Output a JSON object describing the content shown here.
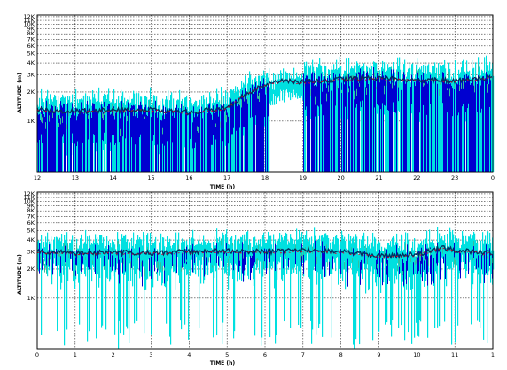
{
  "chart_data": [
    {
      "type": "area",
      "title": "",
      "xlabel": "TIME (h)",
      "ylabel": "ALTITUDE (m)",
      "x_ticks": [
        "12",
        "13",
        "14",
        "15",
        "16",
        "17",
        "18",
        "19",
        "20",
        "21",
        "22",
        "23",
        "0"
      ],
      "xlim": [
        12,
        24
      ],
      "y_ticks": [
        "12K",
        "11K",
        "10K",
        "9K",
        "8K",
        "7K",
        "6K",
        "5K",
        "4K",
        "3K",
        "2K",
        "1K"
      ],
      "y_scale": "log",
      "grid": true,
      "colors": {
        "low": "#00e0e0",
        "mid": "#0000d0",
        "high": "#30c0a0",
        "top": "#d00030",
        "dark": "#003060"
      },
      "series": [
        {
          "values": [
            {
              "x": 12.0,
              "y": 1300
            },
            {
              "x": 13.0,
              "y": 1250
            },
            {
              "x": 14.0,
              "y": 1280
            },
            {
              "x": 15.0,
              "y": 1300
            },
            {
              "x": 16.0,
              "y": 1220
            },
            {
              "x": 17.0,
              "y": 1350
            },
            {
              "x": 17.8,
              "y": 2200
            },
            {
              "x": 18.5,
              "y": 2600
            },
            {
              "x": 19.0,
              "y": 2500
            },
            {
              "x": 20.0,
              "y": 2700
            },
            {
              "x": 21.0,
              "y": 2750
            },
            {
              "x": 22.0,
              "y": 2650
            },
            {
              "x": 23.0,
              "y": 2600
            },
            {
              "x": 24.0,
              "y": 2800
            }
          ]
        }
      ]
    },
    {
      "type": "area",
      "title": "",
      "xlabel": "TIME (h)",
      "ylabel": "ALTITUDE (m)",
      "x_ticks": [
        "0",
        "1",
        "2",
        "3",
        "4",
        "5",
        "6",
        "7",
        "8",
        "9",
        "10",
        "11",
        "1"
      ],
      "xlim": [
        0,
        12
      ],
      "y_ticks": [
        "12K",
        "11K",
        "10K",
        "9K",
        "8K",
        "7K",
        "6K",
        "5K",
        "4K",
        "3K",
        "2K",
        "1K"
      ],
      "y_scale": "log",
      "grid": true,
      "colors": {
        "low": "#00e0e0",
        "mid": "#0000d0",
        "high": "#30c0a0",
        "top": "#d00030",
        "dark": "#003060"
      },
      "series": [
        {
          "values": [
            {
              "x": 0.0,
              "y": 3000
            },
            {
              "x": 1.0,
              "y": 2900
            },
            {
              "x": 2.0,
              "y": 2950
            },
            {
              "x": 3.0,
              "y": 2900
            },
            {
              "x": 4.0,
              "y": 3000
            },
            {
              "x": 5.0,
              "y": 3050
            },
            {
              "x": 6.0,
              "y": 3000
            },
            {
              "x": 7.0,
              "y": 3100
            },
            {
              "x": 8.0,
              "y": 3000
            },
            {
              "x": 9.0,
              "y": 2700
            },
            {
              "x": 10.0,
              "y": 2800
            },
            {
              "x": 10.7,
              "y": 3300
            },
            {
              "x": 11.0,
              "y": 3100
            },
            {
              "x": 12.0,
              "y": 2900
            }
          ]
        }
      ]
    }
  ]
}
